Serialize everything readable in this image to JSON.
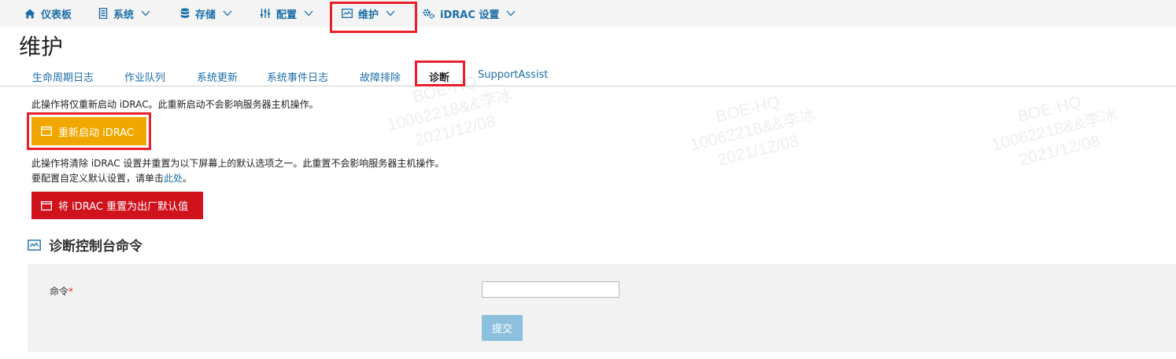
{
  "nav": {
    "items": [
      {
        "label": "仪表板",
        "icon": "home-icon"
      },
      {
        "label": "系统",
        "icon": "server-icon"
      },
      {
        "label": "存储",
        "icon": "database-icon"
      },
      {
        "label": "配置",
        "icon": "sliders-icon"
      },
      {
        "label": "维护",
        "icon": "maintenance-icon",
        "active": true
      },
      {
        "label": "iDRAC 设置",
        "icon": "gears-icon"
      }
    ]
  },
  "page": {
    "title": "维护"
  },
  "tabs": [
    {
      "label": "生命周期日志"
    },
    {
      "label": "作业队列"
    },
    {
      "label": "系统更新"
    },
    {
      "label": "系统事件日志"
    },
    {
      "label": "故障排除"
    },
    {
      "label": "诊断",
      "active": true
    },
    {
      "label": "SupportAssist"
    }
  ],
  "restart": {
    "description": "此操作将仅重新启动 iDRAC。此重新启动不会影响服务器主机操作。",
    "button_label": "重新启动 iDRAC"
  },
  "reset": {
    "description": "此操作将清除 iDRAC 设置并重置为以下屏幕上的默认选项之一。此重置不会影响服务器主机操作。",
    "custom_prefix": "要配置自定义默认设置，请单击",
    "custom_link": "此处",
    "custom_suffix": "。",
    "button_label": "将 iDRAC 重置为出厂默认值"
  },
  "diagnostics": {
    "section_title": "诊断控制台命令",
    "command_label": "命令",
    "required_mark": "*",
    "command_value": "",
    "submit_label": "提交"
  },
  "watermark": {
    "line1": "BOE-HQ",
    "line2": "10062218&&李冰",
    "line3": "2021/12/08"
  },
  "colors": {
    "accent": "#1b6ea8",
    "restart_button": "#f0a800",
    "reset_button": "#d0121d",
    "highlight_border": "#e8202a",
    "submit_button": "#8cc0dc"
  }
}
